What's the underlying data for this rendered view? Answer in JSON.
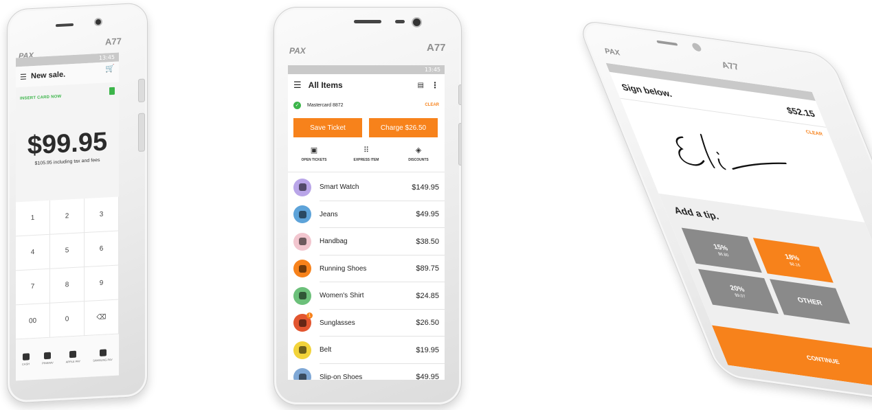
{
  "colors": {
    "accent": "#f7821b",
    "success": "#3cb54a",
    "tip_gray": "#8a8a8a"
  },
  "left_device": {
    "brand": "PAX",
    "model": "A77",
    "status_time": "13:45",
    "menu_icon": "hamburger-icon",
    "cart_icon": "cart-icon",
    "title": "New sale.",
    "insert_card": "INSERT CARD NOW",
    "amount": "$99.95",
    "subtext": "$105.95 including tax and fees",
    "keys": [
      "1",
      "2",
      "3",
      "4",
      "5",
      "6",
      "7",
      "8",
      "9",
      "00",
      "0",
      "⌫"
    ],
    "payments": [
      {
        "icon": "qr-icon",
        "label": "CASH"
      },
      {
        "icon": "card-icon",
        "label": "PIN/EMV"
      },
      {
        "icon": "apple-pay-icon",
        "label": "APPLE PAY"
      },
      {
        "icon": "samsung-pay-icon",
        "label": "SAMSUNG PAY"
      }
    ]
  },
  "middle_device": {
    "brand": "PAX",
    "model": "A77",
    "status_time": "13:45",
    "title": "All Items",
    "card": {
      "label": "Mastercard 8872",
      "clear": "CLEAR"
    },
    "buttons": {
      "save": "Save Ticket",
      "charge": "Charge $26.50"
    },
    "tabs": [
      {
        "label": "OPEN TICKETS",
        "icon": "ticket-icon"
      },
      {
        "label": "EXPRESS ITEM",
        "icon": "grid-icon"
      },
      {
        "label": "DISCOUNTS",
        "icon": "tag-icon"
      }
    ],
    "items": [
      {
        "name": "Smart Watch",
        "price": "$149.95",
        "color": "#b9a5e8",
        "badge": ""
      },
      {
        "name": "Jeans",
        "price": "$49.95",
        "color": "#5da3d9",
        "badge": ""
      },
      {
        "name": "Handbag",
        "price": "$38.50",
        "color": "#f2c6cf",
        "badge": ""
      },
      {
        "name": "Running Shoes",
        "price": "$89.75",
        "color": "#f7821b",
        "badge": ""
      },
      {
        "name": "Women's Shirt",
        "price": "$24.85",
        "color": "#6cc07a",
        "badge": ""
      },
      {
        "name": "Sunglasses",
        "price": "$26.50",
        "color": "#e2552f",
        "badge": "1"
      },
      {
        "name": "Belt",
        "price": "$19.95",
        "color": "#f2d33a",
        "badge": ""
      },
      {
        "name": "Slip-on Shoes",
        "price": "$49.95",
        "color": "#7fa8d6",
        "badge": ""
      }
    ]
  },
  "right_device": {
    "brand": "PAX",
    "model": "A77",
    "title": "Sign below.",
    "amount": "$52.15",
    "clear": "CLEAR",
    "tip_title": "Add a tip.",
    "tips": [
      {
        "pct": "15%",
        "amt": "$6.80",
        "selected": false
      },
      {
        "pct": "18%",
        "amt": "$8.16",
        "selected": true
      },
      {
        "pct": "20%",
        "amt": "$9.07",
        "selected": false
      },
      {
        "pct": "OTHER",
        "amt": "",
        "selected": false
      }
    ],
    "continue": "CONTINUE"
  }
}
